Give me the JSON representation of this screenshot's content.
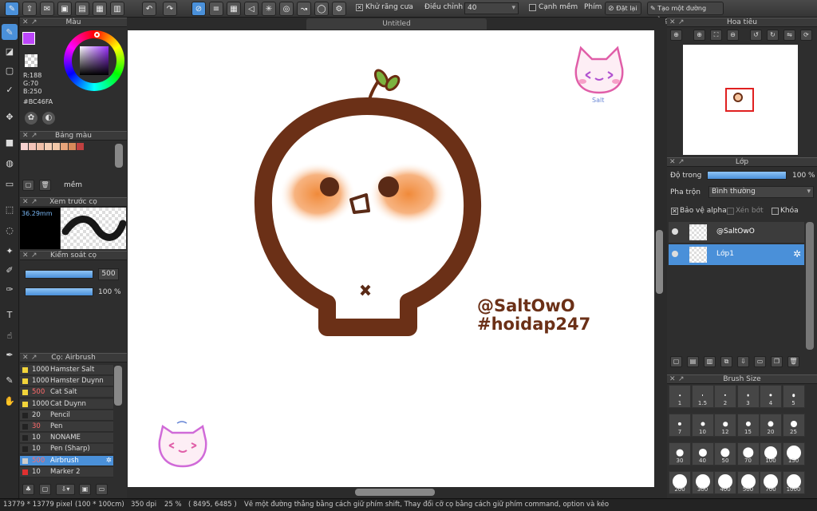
{
  "toolbar": {
    "antialias_label": "Khử răng cưa",
    "adjust_label": "Điều chỉnh",
    "adjust_value": "40",
    "sharp_edge_label": "Cạnh mềm",
    "key_label": "Phím",
    "reset_label": "Đặt lại",
    "create_line_label": "Tạo một đường thẳng"
  },
  "document": {
    "title": "Untitled"
  },
  "color_panel": {
    "title": "Màu",
    "r": "R:188",
    "g": "G:70",
    "b": "B:250",
    "hex": "#BC46FA",
    "fg_color": "#bc46fa"
  },
  "palette_panel": {
    "title": "Bảng màu",
    "swatches": [
      "#f6d1cf",
      "#f3c3b8",
      "#f0bfa8",
      "#f5ceb5",
      "#f2c7a8",
      "#e7a47a",
      "#d98a5a",
      "#c04040"
    ],
    "soft_label": "mềm"
  },
  "brush_preview": {
    "title": "Xem trước cọ",
    "size": "36.29mm"
  },
  "brush_control": {
    "title": "Kiểm soát cọ",
    "size_value": "500",
    "opacity_value": "100 %"
  },
  "brush_list": {
    "title": "Cọ: Airbrush",
    "items": [
      {
        "size": "1000",
        "name": "Hamster Salt",
        "color": "#f2d43a"
      },
      {
        "size": "1000",
        "name": "Hamster Duynn",
        "color": "#f2d43a"
      },
      {
        "size": "500",
        "name": "Cat Salt",
        "color": "#f2d43a",
        "red": true
      },
      {
        "size": "1000",
        "name": "Cat Duynn",
        "color": "#f2d43a"
      },
      {
        "size": "20",
        "name": "Pencil",
        "color": "#222"
      },
      {
        "size": "30",
        "name": "Pen",
        "color": "#222",
        "red": true
      },
      {
        "size": "10",
        "name": "NONAME",
        "color": "#222"
      },
      {
        "size": "10",
        "name": "Pen (Sharp)",
        "color": "#222"
      },
      {
        "size": "500",
        "name": "Airbrush",
        "color": "#ccc",
        "red": true
      },
      {
        "size": "10",
        "name": "Marker 2",
        "color": "#e03030"
      }
    ]
  },
  "navigator": {
    "title": "Hoa tiêu"
  },
  "layers": {
    "title": "Lớp",
    "opacity_label": "Độ trong",
    "opacity_value": "100 %",
    "blend_label": "Pha trộn",
    "blend_value": "Bình thường",
    "protect_alpha": "Bảo vệ alpha",
    "clip_label": "Xén bớt",
    "lock_label": "Khóa",
    "items": [
      {
        "name": "@SaltOwO",
        "selected": false
      },
      {
        "name": "Lớp1",
        "selected": true
      }
    ]
  },
  "brush_size": {
    "title": "Brush Size",
    "sizes": [
      "1",
      "1.5",
      "2",
      "3",
      "4",
      "5",
      "7",
      "10",
      "12",
      "15",
      "20",
      "25",
      "30",
      "40",
      "50",
      "70",
      "100",
      "150",
      "200",
      "300",
      "400",
      "500",
      "700",
      "1000"
    ]
  },
  "canvas": {
    "watermark_line1": "@SaltOwO",
    "watermark_line2": "#hoidap247",
    "sticker_text": "Salt"
  },
  "status": {
    "dims": "13779 * 13779 pixel",
    "physical": "(100 * 100cm)",
    "dpi": "350 dpi",
    "zoom": "25 %",
    "coords": "( 8495, 6485 )",
    "hint": "Vẽ một đường thẳng bằng cách giữ phím shift, Thay đổi cỡ cọ bằng cách giữ phím command, option và kéo"
  }
}
